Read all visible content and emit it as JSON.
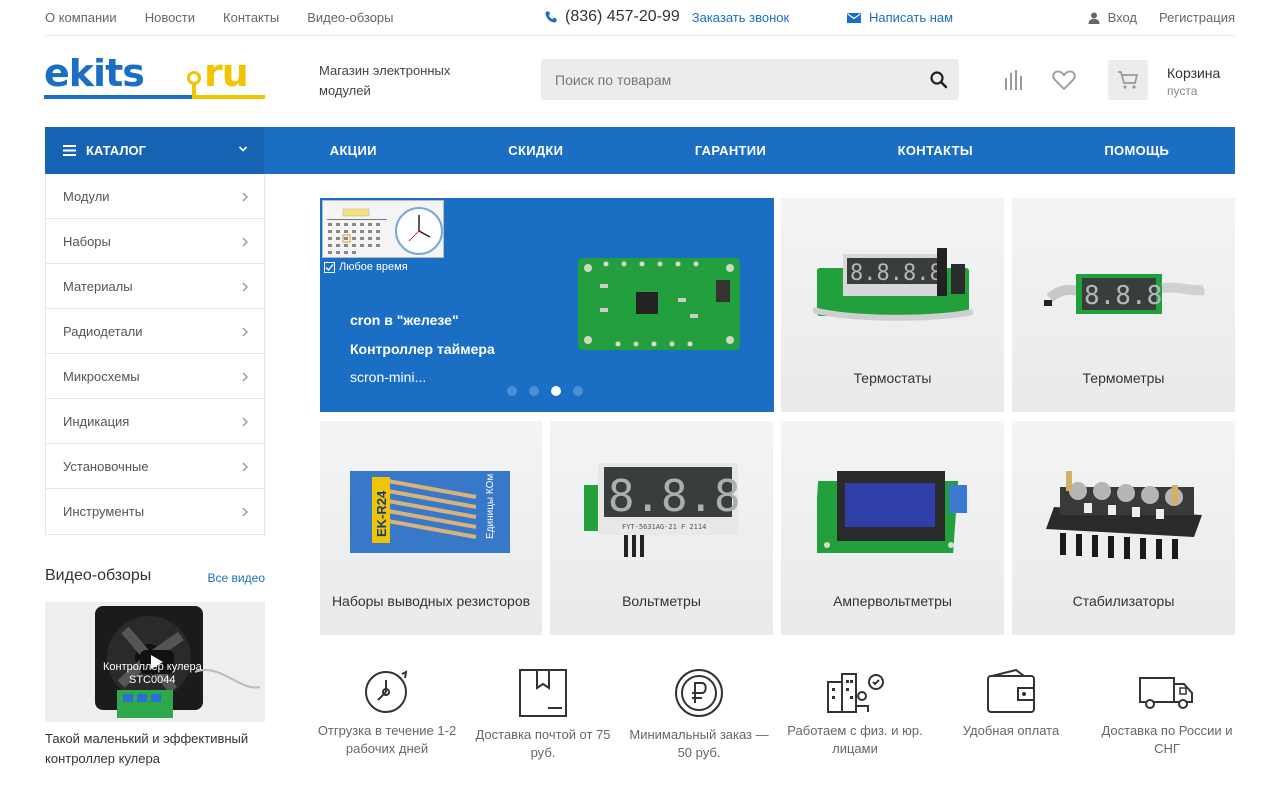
{
  "topbar": {
    "links": [
      "О компании",
      "Новости",
      "Контакты",
      "Видео-обзоры"
    ],
    "phone": "(836) 457-20-99",
    "callback": "Заказать звонок",
    "write": "Написать нам",
    "login": "Вход",
    "register": "Регистрация"
  },
  "header": {
    "tagline": "Магазин электронных модулей",
    "search_placeholder": "Поиск по товарам",
    "cart_title": "Корзина",
    "cart_status": "пуста"
  },
  "nav": {
    "catalog": "КАТАЛОГ",
    "items": [
      "АКЦИИ",
      "СКИДКИ",
      "ГАРАНТИИ",
      "КОНТАКТЫ",
      "ПОМОЩЬ"
    ]
  },
  "sidebar": {
    "items": [
      "Модули",
      "Наборы",
      "Материалы",
      "Радиодетали",
      "Микросхемы",
      "Индикация",
      "Установочные",
      "Инструменты"
    ]
  },
  "videos": {
    "title": "Видео-обзоры",
    "all": "Все видео",
    "overlay": "Контроллер кулера STC0044",
    "caption": "Такой маленький и эффективный контроллер кулера"
  },
  "banner": {
    "calendar_label": "Любое время",
    "line1": "cron в \"железе\"",
    "line2": "Контроллер таймера",
    "line3": "scron-mini...",
    "slides": 4,
    "active_slide": 3
  },
  "tiles": [
    "Термостаты",
    "Термометры",
    "Наборы выводных резисторов",
    "Вольтметры",
    "Ампервольтметры",
    "Стабилизаторы"
  ],
  "features": [
    "Отгрузка в течение 1-2 рабочих дней",
    "Доставка почтой от 75 руб.",
    "Минимальный заказ — 50 руб.",
    "Работаем с физ. и юр. лицами",
    "Удобная оплата",
    "Доставка по России и СНГ"
  ],
  "colors": {
    "primary": "#1a6fc4",
    "catalog": "#1763b3",
    "logo_yellow": "#f2c300"
  }
}
